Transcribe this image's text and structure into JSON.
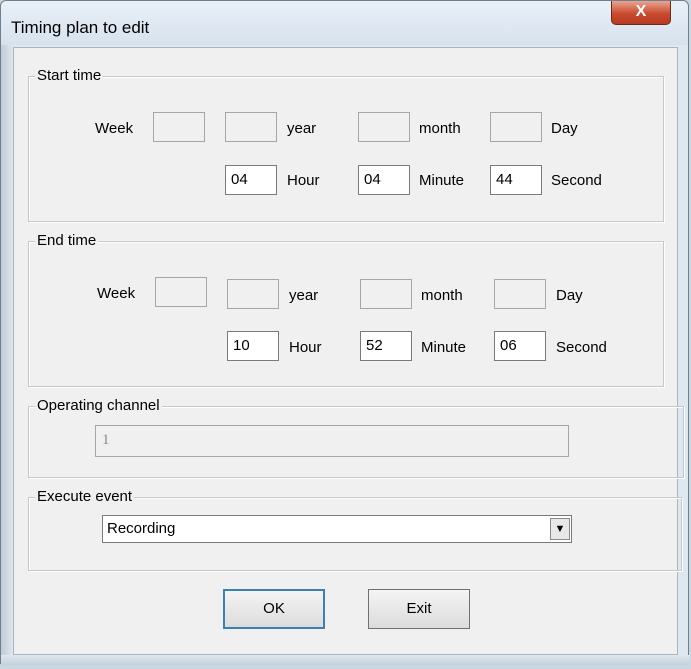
{
  "window": {
    "title": "Timing plan to edit",
    "close_label": "X"
  },
  "start_time": {
    "legend": "Start time",
    "week_label": "Week",
    "week_value": "",
    "year_value": "",
    "year_label": "year",
    "month_value": "",
    "month_label": "month",
    "day_value": "",
    "day_label": "Day",
    "hour_value": "04",
    "hour_label": "Hour",
    "minute_value": "04",
    "minute_label": "Minute",
    "second_value": "44",
    "second_label": "Second"
  },
  "end_time": {
    "legend": "End time",
    "week_label": "Week",
    "week_value": "",
    "year_value": "",
    "year_label": "year",
    "month_value": "",
    "month_label": "month",
    "day_value": "",
    "day_label": "Day",
    "hour_value": "10",
    "hour_label": "Hour",
    "minute_value": "52",
    "minute_label": "Minute",
    "second_value": "06",
    "second_label": "Second"
  },
  "operating_channel": {
    "legend": "Operating channel",
    "value": "1"
  },
  "execute_event": {
    "legend": "Execute event",
    "selected": "Recording",
    "dropdown_icon": "▼"
  },
  "buttons": {
    "ok": "OK",
    "exit": "Exit"
  }
}
